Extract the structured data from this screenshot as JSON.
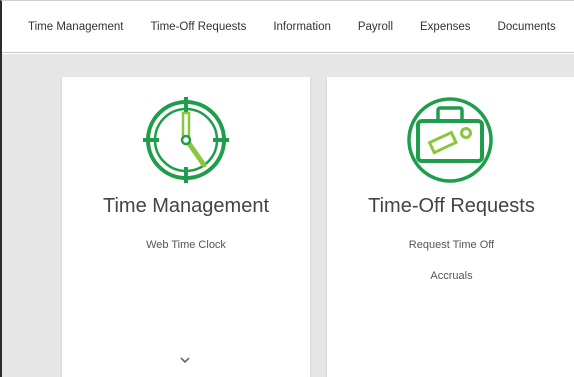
{
  "nav": {
    "items": [
      {
        "label": "Time Management"
      },
      {
        "label": "Time-Off Requests"
      },
      {
        "label": "Information"
      },
      {
        "label": "Payroll"
      },
      {
        "label": "Expenses"
      },
      {
        "label": "Documents"
      }
    ]
  },
  "cards": [
    {
      "title": "Time Management",
      "icon": "clock-icon",
      "links": [
        "Web Time Clock"
      ]
    },
    {
      "title": "Time-Off Requests",
      "icon": "suitcase-icon",
      "links": [
        "Request Time Off",
        "Accruals"
      ]
    }
  ],
  "colors": {
    "accent_dark": "#1e9e4a",
    "accent_light": "#8cc63f",
    "background": "#e6e6e6"
  }
}
